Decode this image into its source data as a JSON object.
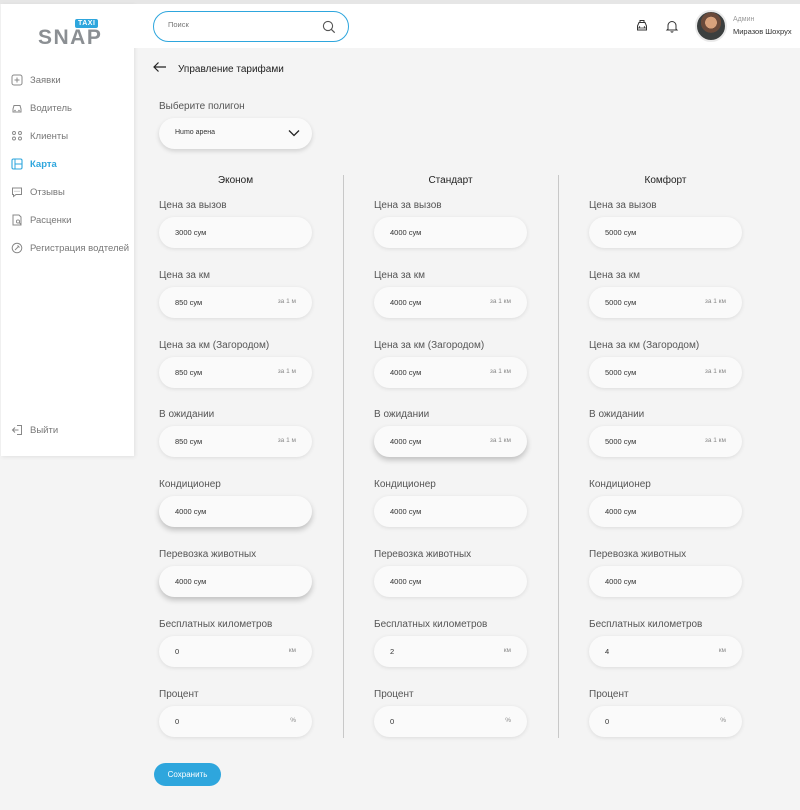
{
  "header": {
    "search_placeholder": "Поиск",
    "user_role": "Админ",
    "user_name": "Миразов Шохрух"
  },
  "logo": {
    "name": "SNAP",
    "tag": "TAXI"
  },
  "sidebar": {
    "items": [
      {
        "label": "Заявки",
        "icon": "plus-square-icon"
      },
      {
        "label": "Водитель",
        "icon": "car-icon"
      },
      {
        "label": "Клиенты",
        "icon": "users-icon"
      },
      {
        "label": "Карта",
        "icon": "map-icon",
        "active": true
      },
      {
        "label": "Отзывы",
        "icon": "chat-icon"
      },
      {
        "label": "Расценки",
        "icon": "price-doc-icon"
      },
      {
        "label": "Регистрация водтелей",
        "icon": "register-driver-icon"
      }
    ],
    "logout": "Выйти"
  },
  "page": {
    "title": "Управление тарифами",
    "polygon_label": "Выберите полигон",
    "polygon_value": "Humo арена"
  },
  "columns": [
    {
      "title": "Эконом",
      "fields": [
        {
          "label": "Цена за вызов",
          "value": "3000 сум",
          "unit": ""
        },
        {
          "label": "Цена за км",
          "value": "850 сум",
          "unit": "за 1 м"
        },
        {
          "label": "Цена за км (Загородом)",
          "value": "850 сум",
          "unit": "за 1 м"
        },
        {
          "label": "В ожидании",
          "value": "850 сум",
          "unit": "за 1 м"
        },
        {
          "label": "Кондиционер",
          "value": "4000 сум",
          "unit": ""
        },
        {
          "label": "Перевозка животных",
          "value": "4000 сум",
          "unit": ""
        },
        {
          "label": "Бесплатных километров",
          "value": "0",
          "unit": "км"
        },
        {
          "label": "Процент",
          "value": "0",
          "unit": "%"
        }
      ]
    },
    {
      "title": "Стандарт",
      "fields": [
        {
          "label": "Цена за вызов",
          "value": "4000 сум",
          "unit": ""
        },
        {
          "label": "Цена за км",
          "value": "4000 сум",
          "unit": "за 1 км"
        },
        {
          "label": "Цена за км (Загородом)",
          "value": "4000 сум",
          "unit": "за 1 км"
        },
        {
          "label": "В ожидании",
          "value": "4000 сум",
          "unit": "за 1 км"
        },
        {
          "label": "Кондиционер",
          "value": "4000 сум",
          "unit": ""
        },
        {
          "label": "Перевозка животных",
          "value": "4000 сум",
          "unit": ""
        },
        {
          "label": "Бесплатных километров",
          "value": "2",
          "unit": "км"
        },
        {
          "label": "Процент",
          "value": "0",
          "unit": "%"
        }
      ]
    },
    {
      "title": "Комфорт",
      "fields": [
        {
          "label": "Цена за вызов",
          "value": "5000 сум",
          "unit": ""
        },
        {
          "label": "Цена за км",
          "value": "5000 сум",
          "unit": "за 1 км"
        },
        {
          "label": "Цена за км (Загородом)",
          "value": "5000 сум",
          "unit": "за 1 км"
        },
        {
          "label": "В ожидании",
          "value": "5000 сум",
          "unit": "за 1 км"
        },
        {
          "label": "Кондиционер",
          "value": "4000 сум",
          "unit": ""
        },
        {
          "label": "Перевозка животных",
          "value": "4000 сум",
          "unit": ""
        },
        {
          "label": "Бесплатных километров",
          "value": "4",
          "unit": "км"
        },
        {
          "label": "Процент",
          "value": "0",
          "unit": "%"
        }
      ]
    }
  ],
  "save_label": "Сохранить",
  "colors": {
    "accent": "#2ea6dd",
    "logo_gray": "#8b8f93"
  }
}
